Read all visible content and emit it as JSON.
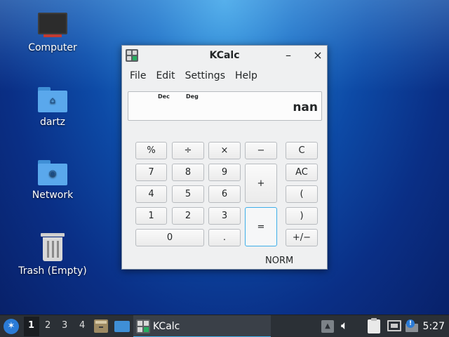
{
  "desktop": {
    "icons": [
      {
        "label": "Computer"
      },
      {
        "label": "dartz"
      },
      {
        "label": "Network"
      },
      {
        "label": "Trash (Empty)"
      }
    ]
  },
  "window": {
    "title": "KCalc",
    "minimize": "–",
    "close": "×",
    "menu": [
      "File",
      "Edit",
      "Settings",
      "Help"
    ],
    "display": {
      "base_flag": "Dec",
      "angle_flag": "Deg",
      "value": "nan"
    },
    "buttons": {
      "percent": "%",
      "divide": "÷",
      "multiply": "×",
      "minus": "−",
      "clear": "C",
      "seven": "7",
      "eight": "8",
      "nine": "9",
      "plus": "+",
      "all_clear": "AC",
      "four": "4",
      "five": "5",
      "six": "6",
      "open_paren": "(",
      "one": "1",
      "two": "2",
      "three": "3",
      "equals": "=",
      "close_paren": ")",
      "zero": "0",
      "decimal": ".",
      "plus_minus": "+/−"
    },
    "status": "NORM"
  },
  "taskbar": {
    "workspaces": [
      "1",
      "2",
      "3",
      "4"
    ],
    "active_workspace": "1",
    "task_label": "KCalc",
    "clock": "5:27",
    "icons": [
      "start-menu-icon",
      "file-manager-icon",
      "show-desktop-icon",
      "kcalc-icon",
      "tray-up-icon",
      "volume-icon",
      "clipboard-icon",
      "network-icon",
      "notification-icon"
    ]
  },
  "colors": {
    "accent": "#3daee9",
    "taskbar": "#2b3036",
    "window": "#eff0f1"
  }
}
